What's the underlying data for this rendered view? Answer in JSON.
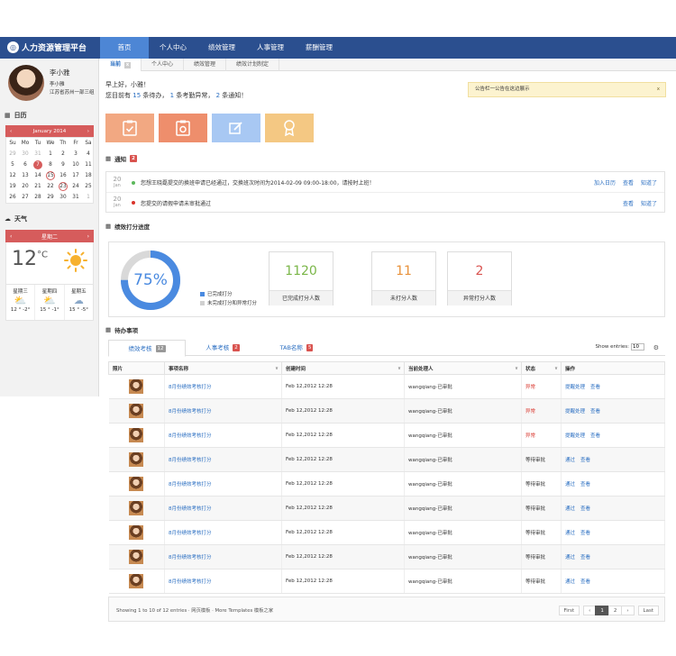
{
  "app": {
    "title": "人力资源管理平台"
  },
  "nav": [
    "首页",
    "个人中心",
    "绩效管理",
    "人事管理",
    "薪酬管理"
  ],
  "subtabs": [
    "当前",
    "个人中心",
    "绩效管理",
    "绩效计划制定"
  ],
  "user": {
    "name": "李小雅",
    "line1": "李小雅",
    "line2": "江苏省苏州一部三组"
  },
  "calendar": {
    "section": "日历",
    "month": "January 2014",
    "prev": "‹",
    "next": "›",
    "dow": [
      "Su",
      "Mo",
      "Tu",
      "We",
      "Th",
      "Fr",
      "Sa"
    ],
    "weeks": [
      [
        "29",
        "30",
        "31",
        "1",
        "2",
        "3",
        "4"
      ],
      [
        "5",
        "6",
        "7",
        "8",
        "9",
        "10",
        "11"
      ],
      [
        "12",
        "13",
        "14",
        "15",
        "16",
        "17",
        "18"
      ],
      [
        "19",
        "20",
        "21",
        "22",
        "23",
        "24",
        "25"
      ],
      [
        "26",
        "27",
        "28",
        "29",
        "30",
        "31",
        "1"
      ]
    ]
  },
  "weather": {
    "section": "天气",
    "day": "星期二",
    "prev": "‹",
    "next": "›",
    "temp": "12",
    "unit": "°C",
    "forecast": [
      {
        "day": "星期三",
        "range": "12 ° -2°"
      },
      {
        "day": "星期四",
        "range": "15 ° -1°"
      },
      {
        "day": "星期五",
        "range": "15 ° -5°"
      }
    ]
  },
  "greeting": {
    "hello": "早上好，小雅！",
    "p1": "您目前有",
    "tasks": "15",
    "p2": "条待办，",
    "abnormal": "1",
    "p3": "条考勤异常，",
    "notices": "2",
    "p4": "条通知！"
  },
  "announcement": {
    "text": "公告栏一公告在这边展示",
    "close": "x"
  },
  "tiles": [
    {
      "color": "#f2a882",
      "icon": "clipboard-check-icon"
    },
    {
      "color": "#ee8e6c",
      "icon": "clipboard-gear-icon"
    },
    {
      "color": "#a8c8f3",
      "icon": "edit-icon"
    },
    {
      "color": "#f4c883",
      "icon": "award-icon"
    }
  ],
  "notifications": {
    "title": "通知",
    "count": "2",
    "items": [
      {
        "day": "20",
        "month": "Jan",
        "dot": "#5cb85c",
        "text": "您想王晓磊提交的换班申请已经通过，交换班次时间为2014-02-09 09:00-18:00，请按时上班！",
        "links": [
          "加入日历",
          "查看",
          "知道了"
        ]
      },
      {
        "day": "20",
        "month": "Jan",
        "dot": "#d9342b",
        "text": "您提交的请假申请未审批通过",
        "links": [
          "查看",
          "知道了"
        ]
      }
    ]
  },
  "progress": {
    "title": "绩效打分进度",
    "percent": 75,
    "percent_label": "75%",
    "legend": [
      "已完成打分",
      "未完成打分和异常打分"
    ],
    "stats": [
      {
        "value": "1120",
        "label": "已完成打分人数",
        "color": "#7ab648"
      },
      {
        "value": "11",
        "label": "未打分人数",
        "color": "#e8913a"
      },
      {
        "value": "2",
        "label": "异常打分人数",
        "color": "#d9534f"
      }
    ]
  },
  "todo": {
    "title": "待办事项",
    "tabs": [
      {
        "label": "绩效考核",
        "count": "12"
      },
      {
        "label": "人事考核",
        "count": "2"
      },
      {
        "label": "TAB名称",
        "count": "5"
      }
    ],
    "show_entries_label": "Show entries:",
    "show_entries_value": "10",
    "columns": [
      "照片",
      "事项名称",
      "创建时间",
      "当前处理人",
      "状态",
      "操作"
    ],
    "rows": [
      {
        "name": "8月份绩效考核打分",
        "time": "Feb 12,2012 12:28",
        "handler": "wangqiang-已审批",
        "status": "异常",
        "ops": [
          "提醒处理",
          "查看"
        ]
      },
      {
        "name": "8月份绩效考核打分",
        "time": "Feb 12,2012 12:28",
        "handler": "wangqiang-已审批",
        "status": "异常",
        "ops": [
          "提醒处理",
          "查看"
        ]
      },
      {
        "name": "8月份绩效考核打分",
        "time": "Feb 12,2012 12:28",
        "handler": "wangqiang-已审批",
        "status": "异常",
        "ops": [
          "提醒处理",
          "查看"
        ]
      },
      {
        "name": "8月份绩效考核打分",
        "time": "Feb 12,2012 12:28",
        "handler": "wangqiang-已审批",
        "status": "等待审批",
        "ops": [
          "通过",
          "查看"
        ]
      },
      {
        "name": "8月份绩效考核打分",
        "time": "Feb 12,2012 12:28",
        "handler": "wangqiang-已审批",
        "status": "等待审批",
        "ops": [
          "通过",
          "查看"
        ]
      },
      {
        "name": "8月份绩效考核打分",
        "time": "Feb 12,2012 12:28",
        "handler": "wangqiang-已审批",
        "status": "等待审批",
        "ops": [
          "通过",
          "查看"
        ]
      },
      {
        "name": "8月份绩效考核打分",
        "time": "Feb 12,2012 12:28",
        "handler": "wangqiang-已审批",
        "status": "等待审批",
        "ops": [
          "通过",
          "查看"
        ]
      },
      {
        "name": "8月份绩效考核打分",
        "time": "Feb 12,2012 12:28",
        "handler": "wangqiang-已审批",
        "status": "等待审批",
        "ops": [
          "通过",
          "查看"
        ]
      },
      {
        "name": "8月份绩效考核打分",
        "time": "Feb 12,2012 12:28",
        "handler": "wangqiang-已审批",
        "status": "等待审批",
        "ops": [
          "通过",
          "查看"
        ]
      }
    ],
    "footer_info": "Showing 1 to 10 of 12 entries · 网页模板 · More Templates 模板之家",
    "pager": [
      "First",
      "‹",
      "1",
      "2",
      "›",
      "Last"
    ],
    "pager_current": "1"
  }
}
